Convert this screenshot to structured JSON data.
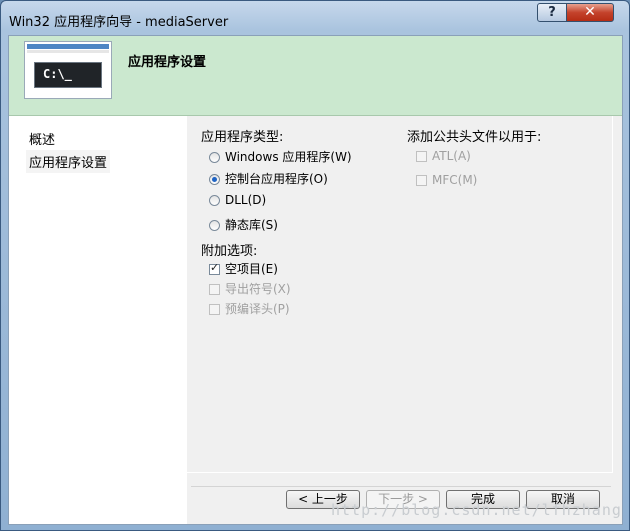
{
  "window": {
    "title": "Win32 应用程序向导 - mediaServer",
    "help_label": "?",
    "close_label": "✕"
  },
  "banner": {
    "title": "应用程序设置",
    "console_text": "C:\\_"
  },
  "nav": {
    "items": [
      {
        "label": "概述"
      },
      {
        "label": "应用程序设置"
      }
    ]
  },
  "app_type": {
    "label": "应用程序类型:",
    "options": [
      {
        "label": "Windows 应用程序(W)",
        "selected": false
      },
      {
        "label": "控制台应用程序(O)",
        "selected": true
      },
      {
        "label": "DLL(D)",
        "selected": false
      },
      {
        "label": "静态库(S)",
        "selected": false
      }
    ]
  },
  "extra": {
    "label": "附加选项:",
    "options": [
      {
        "label": "空项目(E)",
        "checked": true,
        "enabled": true
      },
      {
        "label": "导出符号(X)",
        "checked": false,
        "enabled": false
      },
      {
        "label": "预编译头(P)",
        "checked": false,
        "enabled": false
      }
    ]
  },
  "headers": {
    "label": "添加公共头文件以用于:",
    "options": [
      {
        "label": "ATL(A)",
        "checked": false,
        "enabled": false
      },
      {
        "label": "MFC(M)",
        "checked": false,
        "enabled": false
      }
    ]
  },
  "buttons": {
    "prev": "< 上一步",
    "next": "下一步 >",
    "finish": "完成",
    "cancel": "取消"
  },
  "watermark": "http://blog.csdn.net/lfhzhang"
}
